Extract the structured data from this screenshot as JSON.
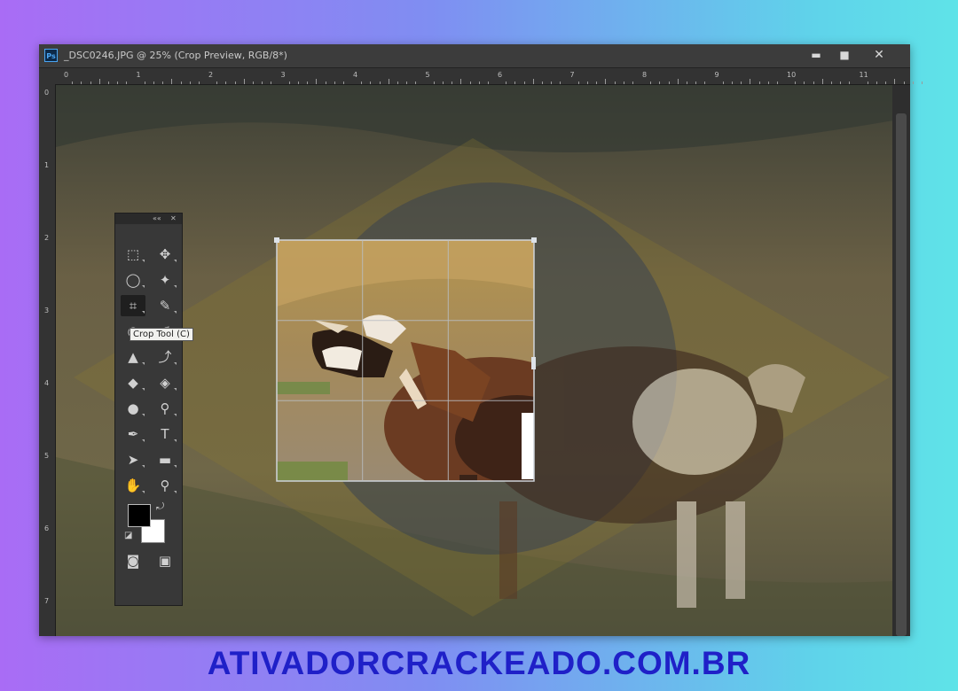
{
  "window": {
    "ps_logo": "Ps",
    "title": "_DSC0246.JPG @ 25% (Crop Preview, RGB/8*)",
    "buttons": {
      "minimize": "▬",
      "maximize": "■",
      "close": "✕"
    }
  },
  "rulers": {
    "top_labels": [
      "0",
      "1",
      "2",
      "3",
      "4",
      "5",
      "6",
      "7",
      "8",
      "9",
      "10",
      "11"
    ],
    "left_labels": [
      "0",
      "1",
      "2",
      "3",
      "4",
      "5",
      "6",
      "7"
    ]
  },
  "toolbar": {
    "collapse_icon": "««",
    "close_icon": "✕",
    "tools": [
      {
        "name": "rect-marquee-tool-icon",
        "glyph": "⬚"
      },
      {
        "name": "move-tool-icon",
        "glyph": "✥"
      },
      {
        "name": "lasso-tool-icon",
        "glyph": "◯"
      },
      {
        "name": "magic-wand-tool-icon",
        "glyph": "✦"
      },
      {
        "name": "crop-tool-icon",
        "glyph": "⌗"
      },
      {
        "name": "eyedropper-tool-icon",
        "glyph": "✎"
      },
      {
        "name": "healing-brush-tool-icon",
        "glyph": "◎"
      },
      {
        "name": "brush-tool-icon",
        "glyph": "✐"
      },
      {
        "name": "clone-stamp-tool-icon",
        "glyph": "▲"
      },
      {
        "name": "history-brush-tool-icon",
        "glyph": "⤴"
      },
      {
        "name": "eraser-tool-icon",
        "glyph": "◆"
      },
      {
        "name": "paint-bucket-tool-icon",
        "glyph": "◈"
      },
      {
        "name": "blur-tool-icon",
        "glyph": "●"
      },
      {
        "name": "dodge-tool-icon",
        "glyph": "⚲"
      },
      {
        "name": "pen-tool-icon",
        "glyph": "✒"
      },
      {
        "name": "type-tool-icon",
        "glyph": "T"
      },
      {
        "name": "path-selection-tool-icon",
        "glyph": "➤"
      },
      {
        "name": "rectangle-shape-tool-icon",
        "glyph": "▬"
      },
      {
        "name": "hand-tool-icon",
        "glyph": "✋"
      },
      {
        "name": "zoom-tool-icon",
        "glyph": "⚲"
      },
      {
        "name": "quick-mask-icon",
        "glyph": "◙"
      },
      {
        "name": "screen-mode-icon",
        "glyph": "▣"
      }
    ],
    "swap_colors_icon": "⤾",
    "default_colors_icon": "◪",
    "foreground_color": "#000000",
    "background_color": "#ffffff",
    "active_tool": "crop-tool-icon"
  },
  "tooltip": {
    "text": "Crop Tool (C)"
  },
  "watermark": {
    "text": "ATIVADORCRACKEADO.COM.BR"
  }
}
